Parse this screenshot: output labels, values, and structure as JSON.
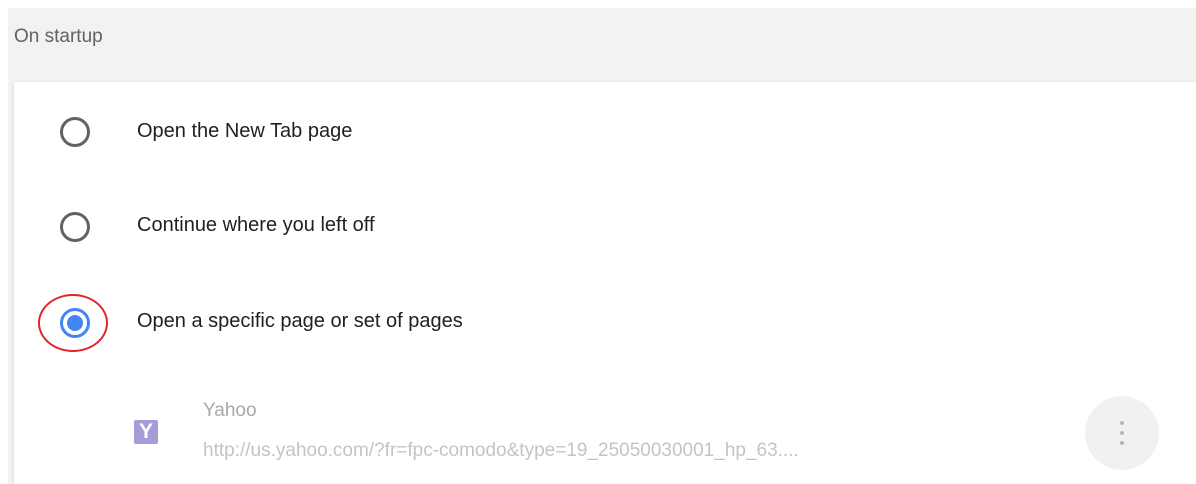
{
  "section": {
    "title": "On startup"
  },
  "options": [
    {
      "label": "Open the New Tab page",
      "selected": false
    },
    {
      "label": "Continue where you left off",
      "selected": false
    },
    {
      "label": "Open a specific page or set of pages",
      "selected": true
    }
  ],
  "startup_page": {
    "favicon_letter": "Y",
    "favicon_icon": "yahoo-favicon",
    "name": "Yahoo",
    "url": "http://us.yahoo.com/?fr=fpc-comodo&type=19_25050030001_hp_63....",
    "more_icon": "more-vert-icon"
  },
  "colors": {
    "accent": "#4285f4",
    "highlight": "#e3242b",
    "favicon_bg": "#a69cd8"
  }
}
